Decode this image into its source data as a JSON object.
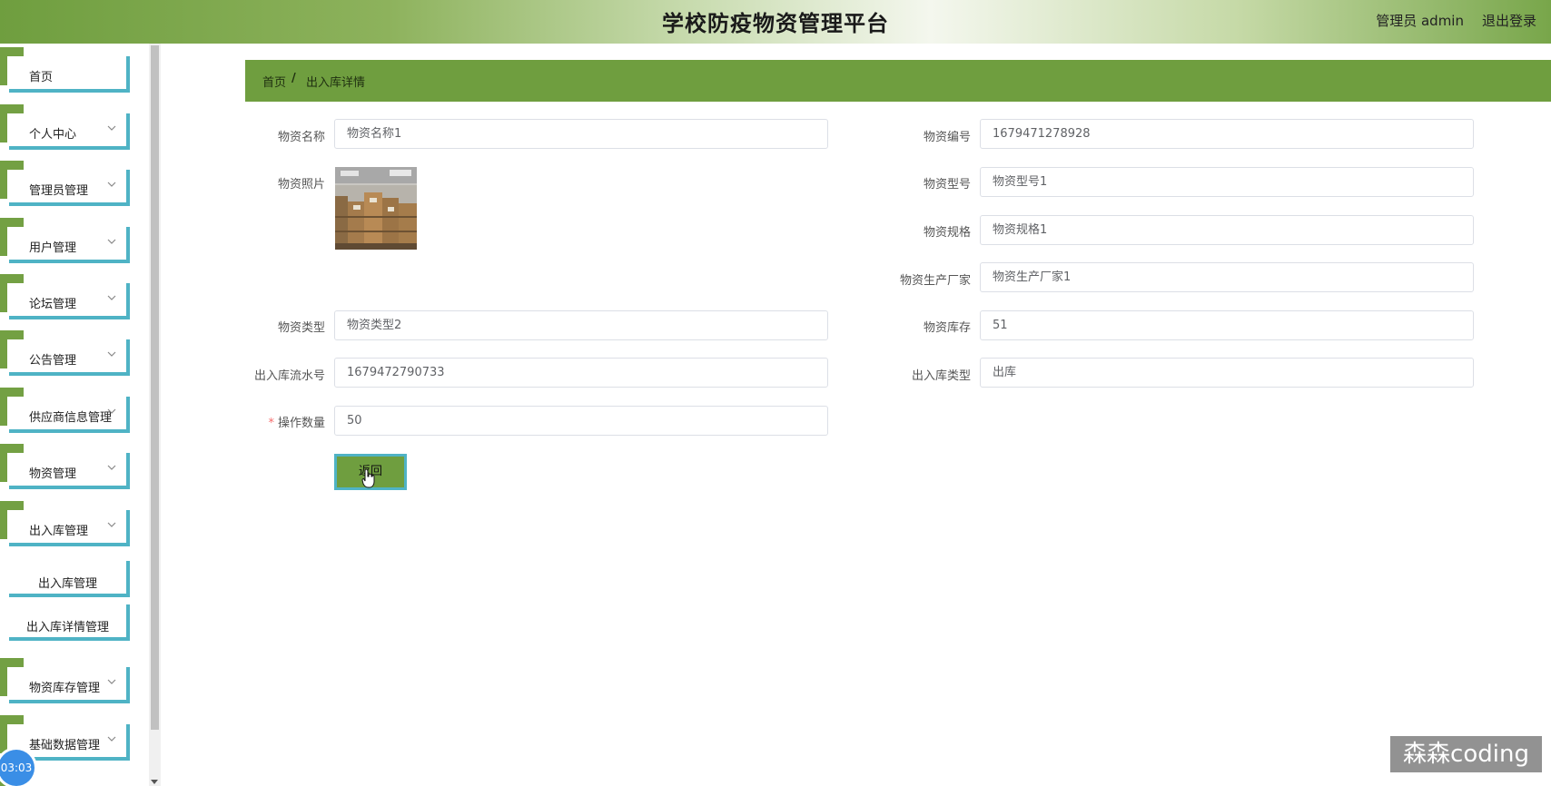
{
  "header": {
    "title": "学校防疫物资管理平台",
    "user_label": "管理员 admin",
    "logout_label": "退出登录"
  },
  "sidebar": {
    "items": [
      {
        "label": "首页",
        "has_chevron": false
      },
      {
        "label": "个人中心",
        "has_chevron": true
      },
      {
        "label": "管理员管理",
        "has_chevron": true
      },
      {
        "label": "用户管理",
        "has_chevron": true
      },
      {
        "label": "论坛管理",
        "has_chevron": true
      },
      {
        "label": "公告管理",
        "has_chevron": true
      },
      {
        "label": "供应商信息管理",
        "has_chevron": true
      },
      {
        "label": "物资管理",
        "has_chevron": true
      },
      {
        "label": "出入库管理",
        "has_chevron": true,
        "expanded": true
      },
      {
        "label": "物资库存管理",
        "has_chevron": true
      },
      {
        "label": "基础数据管理",
        "has_chevron": true
      }
    ],
    "sub_items": [
      {
        "label": "出入库管理"
      },
      {
        "label": "出入库详情管理"
      }
    ]
  },
  "timer": "03:03",
  "breadcrumb": {
    "home": "首页",
    "separator": "/",
    "current": "出入库详情"
  },
  "form": {
    "left": [
      {
        "label": "物资名称",
        "value": "物资名称1"
      },
      {
        "label": "物资照片",
        "value": ""
      },
      {
        "label": "物资类型",
        "value": "物资类型2"
      },
      {
        "label": "出入库流水号",
        "value": "1679472790733"
      },
      {
        "label": "操作数量",
        "value": "50",
        "required": true
      }
    ],
    "right": [
      {
        "label": "物资编号",
        "value": "1679471278928"
      },
      {
        "label": "物资型号",
        "value": "物资型号1"
      },
      {
        "label": "物资规格",
        "value": "物资规格1"
      },
      {
        "label": "物资生产厂家",
        "value": "物资生产厂家1"
      },
      {
        "label": "物资库存",
        "value": "51"
      },
      {
        "label": "出入库类型",
        "value": "出库"
      }
    ],
    "back_label": "返回"
  },
  "watermark": "森森coding",
  "colors": {
    "accent_green": "#6f9e3f",
    "border_teal": "#4fb3c5"
  }
}
